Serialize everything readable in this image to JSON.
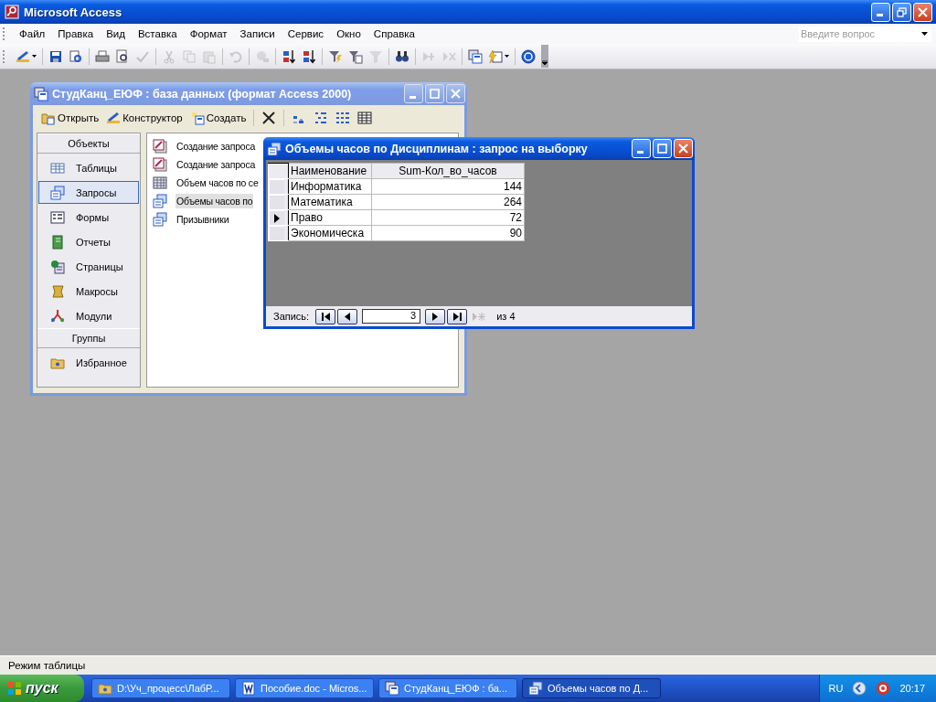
{
  "window": {
    "title": "Microsoft Access"
  },
  "menu": [
    {
      "label": "Файл"
    },
    {
      "label": "Правка"
    },
    {
      "label": "Вид"
    },
    {
      "label": "Вставка"
    },
    {
      "label": "Формат"
    },
    {
      "label": "Записи"
    },
    {
      "label": "Сервис"
    },
    {
      "label": "Окно"
    },
    {
      "label": "Справка"
    }
  ],
  "help_box": {
    "placeholder": "Введите вопрос"
  },
  "toolbar": [
    {
      "kind": "design",
      "disabled": false,
      "dropdown": true
    },
    {
      "kind": "separator"
    },
    {
      "kind": "save",
      "disabled": false
    },
    {
      "kind": "file-search",
      "disabled": false
    },
    {
      "kind": "separator"
    },
    {
      "kind": "print",
      "disabled": false
    },
    {
      "kind": "preview",
      "disabled": false
    },
    {
      "kind": "spelling",
      "disabled": true
    },
    {
      "kind": "separator"
    },
    {
      "kind": "cut",
      "disabled": true
    },
    {
      "kind": "copy",
      "disabled": true
    },
    {
      "kind": "paste",
      "disabled": true
    },
    {
      "kind": "separator"
    },
    {
      "kind": "undo",
      "disabled": true
    },
    {
      "kind": "separator"
    },
    {
      "kind": "hyperlink",
      "disabled": true
    },
    {
      "kind": "separator"
    },
    {
      "kind": "sort-asc",
      "disabled": false
    },
    {
      "kind": "sort-desc",
      "disabled": false
    },
    {
      "kind": "separator"
    },
    {
      "kind": "filter-selection",
      "disabled": false
    },
    {
      "kind": "filter-form",
      "disabled": false
    },
    {
      "kind": "filter",
      "disabled": true
    },
    {
      "kind": "separator"
    },
    {
      "kind": "find",
      "disabled": false
    },
    {
      "kind": "separator"
    },
    {
      "kind": "new-record",
      "disabled": true
    },
    {
      "kind": "delete-record",
      "disabled": true
    },
    {
      "kind": "separator"
    },
    {
      "kind": "database",
      "disabled": false
    },
    {
      "kind": "new-object",
      "disabled": false,
      "dropdown": true
    },
    {
      "kind": "separator"
    },
    {
      "kind": "help",
      "disabled": false
    }
  ],
  "database_window": {
    "title": "СтудКанц_ЕЮФ : база данных (формат Access 2000)",
    "active": false,
    "toolbar": [
      {
        "kind": "open",
        "label": "Открыть"
      },
      {
        "kind": "design",
        "label": "Конструктор"
      },
      {
        "kind": "new",
        "label": "Создать"
      },
      {
        "kind": "delete"
      },
      {
        "kind": "large-icons"
      },
      {
        "kind": "small-icons"
      },
      {
        "kind": "list"
      },
      {
        "kind": "details"
      }
    ],
    "objects_header": "Объекты",
    "objects": [
      {
        "kind": "tables",
        "label": "Таблицы",
        "selected": false
      },
      {
        "kind": "queries",
        "label": "Запросы",
        "selected": true
      },
      {
        "kind": "forms",
        "label": "Формы",
        "selected": false
      },
      {
        "kind": "reports",
        "label": "Отчеты",
        "selected": false
      },
      {
        "kind": "pages",
        "label": "Страницы",
        "selected": false
      },
      {
        "kind": "macros",
        "label": "Макросы",
        "selected": false
      },
      {
        "kind": "modules",
        "label": "Модули",
        "selected": false
      }
    ],
    "groups_header": "Группы",
    "groups": [
      {
        "kind": "favorites",
        "label": "Избранное",
        "selected": false
      }
    ],
    "items": [
      {
        "kind": "wizard",
        "label": "Создание запроса",
        "selected": false
      },
      {
        "kind": "wizard",
        "label": "Создание запроса",
        "selected": false
      },
      {
        "kind": "crosstab",
        "label": "Объем часов по се",
        "selected": false
      },
      {
        "kind": "select",
        "label": "Объемы часов по",
        "selected": true
      },
      {
        "kind": "select",
        "label": "Призывники",
        "selected": false
      }
    ]
  },
  "query_window": {
    "title": "Объемы часов по Дисциплинам : запрос на выборку",
    "active": true,
    "columns": [
      "Наименование",
      "Sum-Кол_во_часов"
    ],
    "rows": [
      {
        "cells": [
          "Информатика",
          "144"
        ],
        "selected": false
      },
      {
        "cells": [
          "Математика",
          "264"
        ],
        "selected": false
      },
      {
        "cells": [
          "Право",
          "72"
        ],
        "selected": true
      },
      {
        "cells": [
          "Экономическа",
          "90"
        ],
        "selected": false
      }
    ],
    "navigator": {
      "label": "Запись:",
      "value": "3",
      "new_disabled": true,
      "total": "из 4"
    }
  },
  "status_bar": "Режим таблицы",
  "taskbar": {
    "start": "пуск",
    "tasks": [
      {
        "kind": "folder",
        "label": "D:\\Уч_процесс\\ЛабР...",
        "selected": false
      },
      {
        "kind": "word",
        "label": "Пособие.doc - Micros...",
        "selected": false
      },
      {
        "kind": "database",
        "label": "СтудКанц_ЕЮФ : ба...",
        "selected": false
      },
      {
        "kind": "query",
        "label": "Объемы часов по Д...",
        "selected": true
      }
    ],
    "language": "RU",
    "clock": "20:17"
  }
}
